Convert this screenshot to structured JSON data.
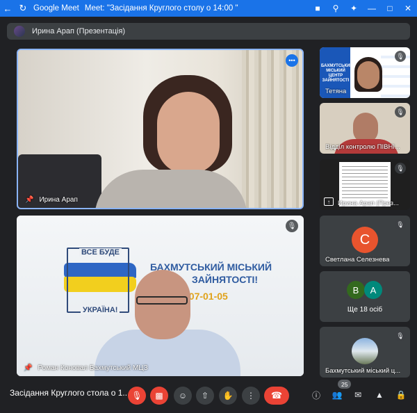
{
  "window": {
    "app": "Google Meet",
    "title": "Meet: \"Засідання Круглого столу о 14:00 \""
  },
  "banner": {
    "text": "Ирина Арап (Презентація)"
  },
  "tiles": {
    "main": {
      "name": "Ирина Арап"
    },
    "second": {
      "name": "Роман Коновал Бахмутський МЦЗ",
      "slide": {
        "top": "ВСЕ БУДЕ",
        "bottom": "УКРАЇНА!",
        "title1": "БАХМУТСЬКИЙ МІСЬКИЙ",
        "title2": "ЗАЙНЯТОСТІ!",
        "phone": "807-01-05"
      }
    }
  },
  "sidebar": [
    {
      "name": "Тетяна",
      "banner_text": "БАХМУТСЬКИЙ МІСЬКИЙ ЦЕНТР ЗАЙНЯТОСТІ"
    },
    {
      "name": "Відділ контролю ПІВНІ..."
    },
    {
      "name": "Ирина Арап (През..."
    },
    {
      "name": "Светлана Селезнева",
      "initial": "С"
    },
    {
      "name": "Ще 18 осіб",
      "initial_1": "В",
      "initial_2": "А"
    },
    {
      "name": "Бахмутський міський ц..."
    }
  ],
  "bottom": {
    "meeting_title": "Засідання Круглого стола о 1...",
    "participants_count": "25"
  },
  "colors": {
    "accent": "#1a73e8",
    "danger": "#ea4335",
    "bg": "#202124",
    "tile": "#3c4043"
  },
  "icons": [
    "back-arrow-icon",
    "reload-icon",
    "camera-icon",
    "zoom-icon",
    "extensions-icon",
    "minimize-icon",
    "maximize-icon",
    "close-icon",
    "mic-off-icon",
    "camera-off-icon",
    "emoji-icon",
    "present-icon",
    "raise-hand-icon",
    "more-options-icon",
    "hangup-icon",
    "info-icon",
    "people-icon",
    "chat-icon",
    "activities-icon",
    "host-controls-icon",
    "pin-icon"
  ]
}
